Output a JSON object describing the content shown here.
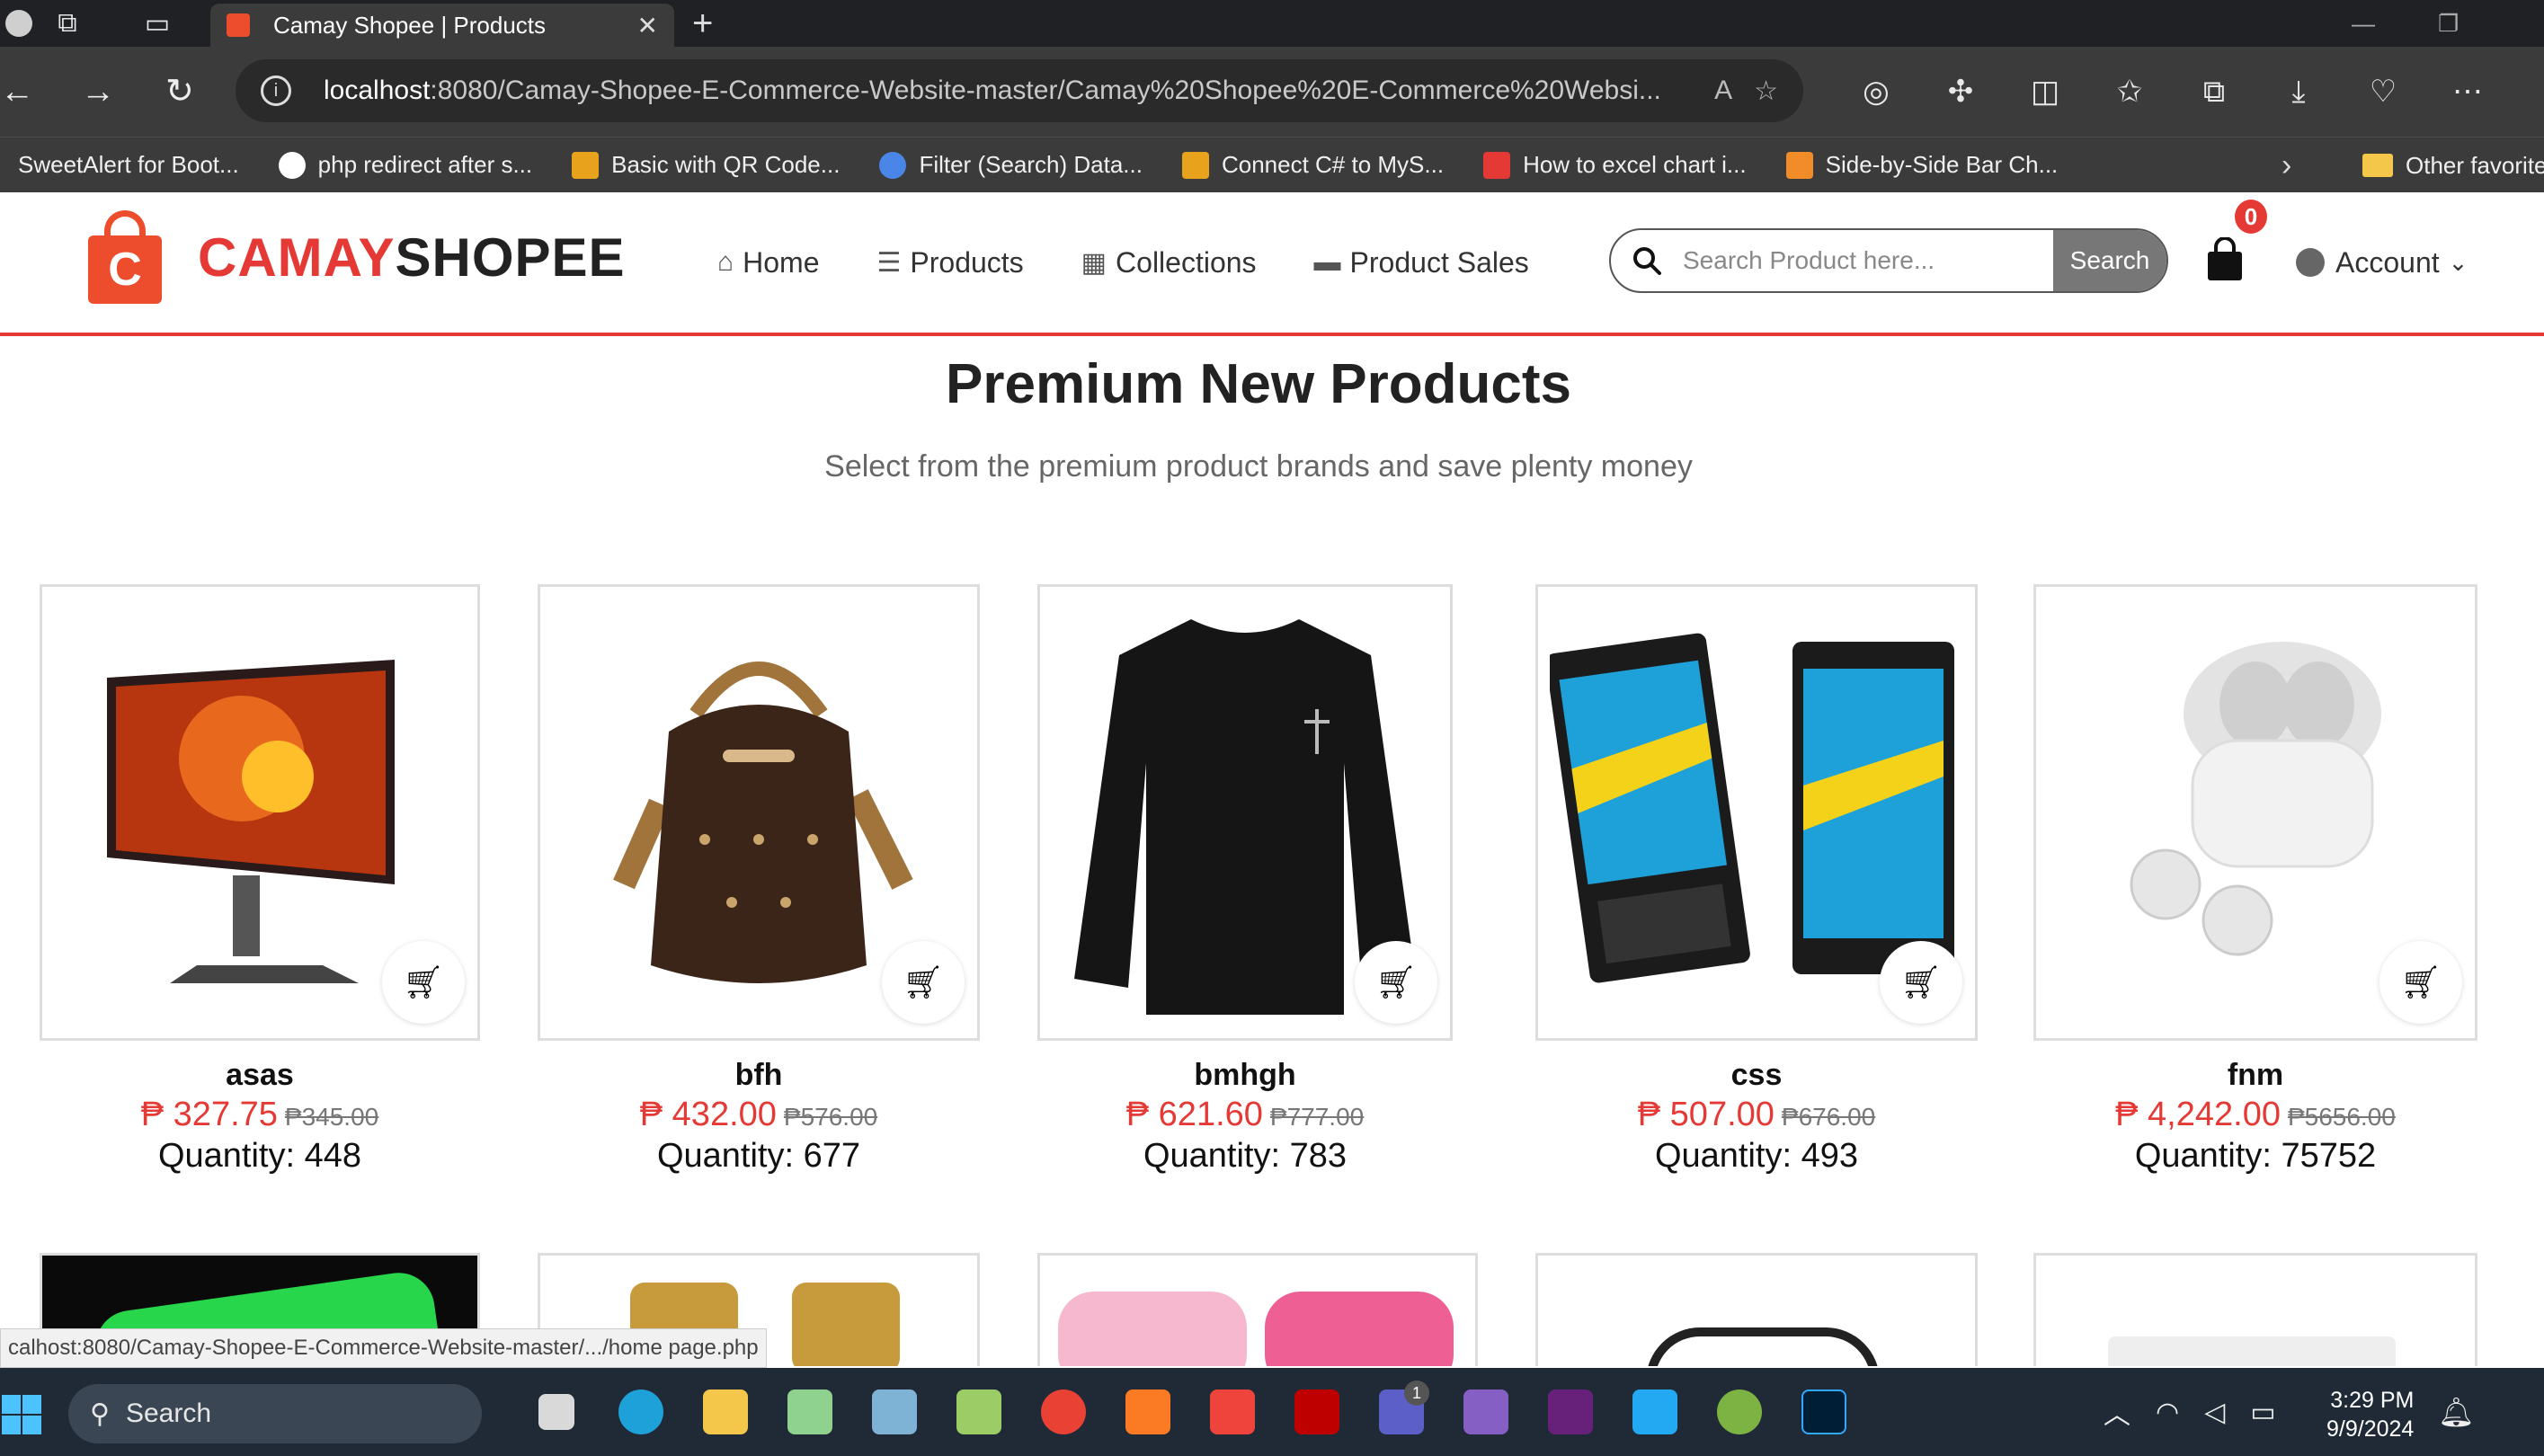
{
  "browser": {
    "tab_title": "Camay Shopee | Products",
    "url_host": "localhost",
    "url_path": ":8080/Camay-Shopee-E-Commerce-Website-master/Camay%20Shopee%20E-Commerce%20Websi...",
    "bookmarks": [
      {
        "label": "SweetAlert for Boot...",
        "color": "#ffffff"
      },
      {
        "label": "php redirect after s...",
        "color": "#ffffff"
      },
      {
        "label": "Basic with QR Code...",
        "color": "#e8a21b"
      },
      {
        "label": "Filter (Search) Data...",
        "color": "#4a86e8"
      },
      {
        "label": "Connect C# to MyS...",
        "color": "#e8a21b"
      },
      {
        "label": "How to excel chart i...",
        "color": "#e53935"
      },
      {
        "label": "Side-by-Side Bar Ch...",
        "color": "#f28c28"
      }
    ],
    "other_favorites": "Other favorite",
    "status_url": "calhost:8080/Camay-Shopee-E-Commerce-Website-master/.../home page.php"
  },
  "site": {
    "logo_part1": "CAMAY",
    "logo_part2": "SHOPEE",
    "logo_letter": "C",
    "nav": [
      {
        "label": "Home",
        "icon": "home-icon"
      },
      {
        "label": "Products",
        "icon": "list-icon"
      },
      {
        "label": "Collections",
        "icon": "collections-icon"
      },
      {
        "label": "Product Sales",
        "icon": "sales-icon"
      }
    ],
    "search_placeholder": "Search Product here...",
    "search_button": "Search",
    "cart_count": "0",
    "account_label": "Account",
    "accent_color": "#e53935",
    "brand_color": "#ee4d2d"
  },
  "main": {
    "title": "Premium New Products",
    "subtitle": "Select from the premium product brands and save plenty money",
    "currency_symbol": "₱",
    "quantity_label": "Quantity: ",
    "products": [
      {
        "name": "asas",
        "price": "327.75",
        "old_price": "₱345.00",
        "quantity": "448",
        "image": "monitor-image"
      },
      {
        "name": "bfh",
        "price": "432.00",
        "old_price": "₱576.00",
        "quantity": "677",
        "image": "backpack-image"
      },
      {
        "name": "bmhgh",
        "price": "621.60",
        "old_price": "₱777.00",
        "quantity": "783",
        "image": "sweater-image"
      },
      {
        "name": "css",
        "price": "507.00",
        "old_price": "₱676.00",
        "quantity": "493",
        "image": "phones-image"
      },
      {
        "name": "fnm",
        "price": "4,242.00",
        "old_price": "₱5656.00",
        "quantity": "75752",
        "image": "earbuds-image"
      }
    ]
  },
  "taskbar": {
    "search_label": "Search",
    "time": "3:29 PM",
    "date": "9/9/2024",
    "teams_badge": "1"
  }
}
